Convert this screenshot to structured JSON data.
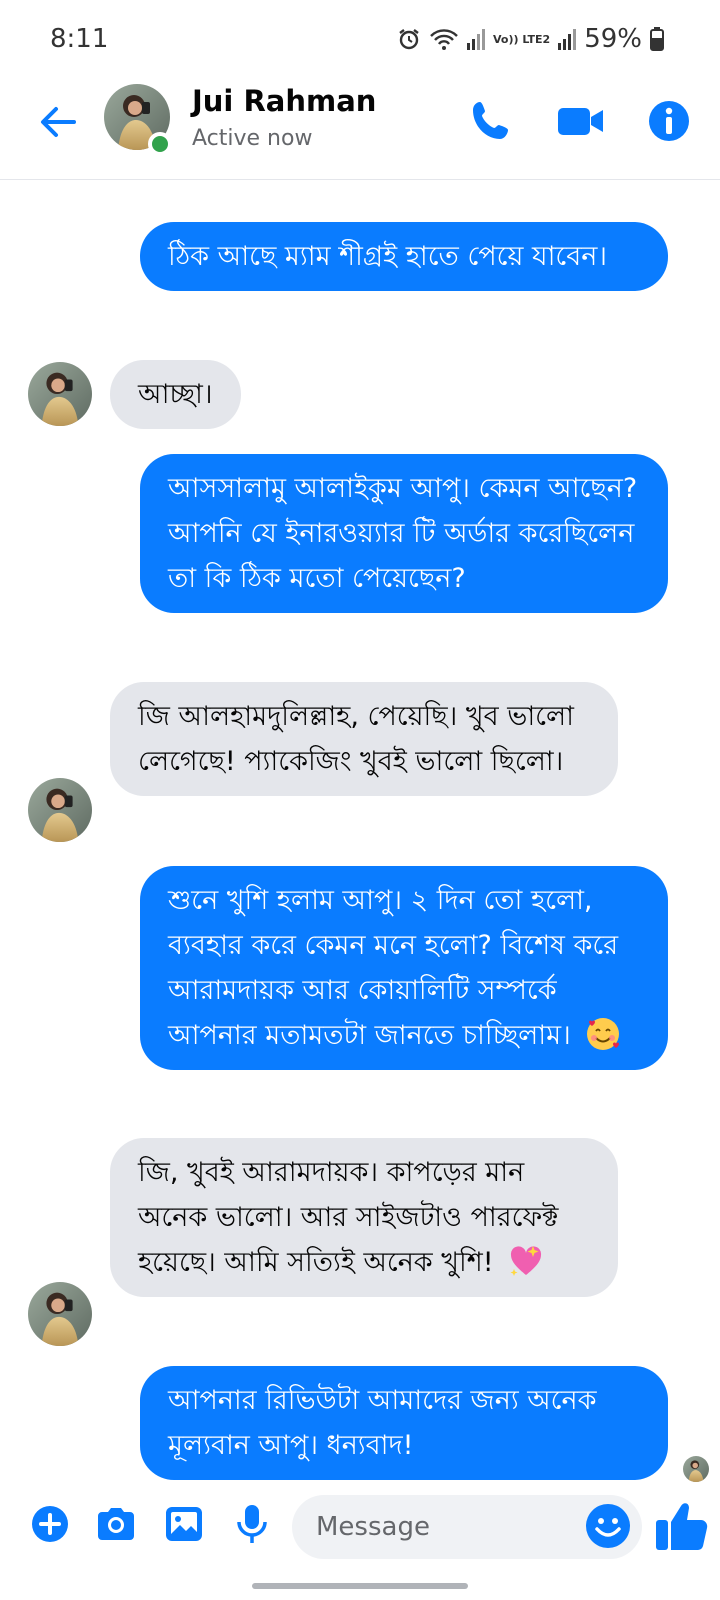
{
  "status_bar": {
    "time": "8:11",
    "network_label": "Vo)) LTE2",
    "battery": "59%"
  },
  "header": {
    "name": "Jui Rahman",
    "status": "Active now"
  },
  "messages": [
    {
      "direction": "out",
      "text": "ঠিক আছে ম্যাম শীগ্রই হাতে পেয়ে যাবেন।"
    },
    {
      "direction": "in",
      "text": "আচ্ছা।"
    },
    {
      "direction": "out",
      "text": "আসসালামু আলাইকুম আপু। কেমন আছেন? আপনি যে ইনারওয়্যার টি অর্ডার করেছিলেন তা কি ঠিক মতো পেয়েছেন?"
    },
    {
      "direction": "in",
      "text": "জি আলহামদুলিল্লাহ, পেয়েছি। খুব ভালো লেগেছে! প্যাকেজিং খুবই ভালো ছিলো।"
    },
    {
      "direction": "out",
      "text": "শুনে খুশি হলাম আপু। ২ দিন তো হলো, ব্যবহার করে কেমন মনে হলো? বিশেষ করে আরামদায়ক আর কোয়ালিটি সম্পর্কে আপনার মতামতটা জানতে চাচ্ছিলাম।",
      "emoji": "smiling-face-with-hearts"
    },
    {
      "direction": "in",
      "text": "জি, খুবই আরামদায়ক। কাপড়ের মান অনেক ভালো। আর সাইজটাও পারফেক্ট হয়েছে। আমি সত্যিই অনেক খুশি!",
      "emoji": "sparkling-heart"
    },
    {
      "direction": "out",
      "text": "আপনার রিভিউটা আমাদের জন্য অনেক মূল্যবান আপু। ধন্যবাদ!"
    }
  ],
  "composer": {
    "placeholder": "Message"
  },
  "colors": {
    "accent": "#0a7cff",
    "incoming_bubble": "#e4e6eb",
    "online": "#31a24c"
  },
  "icons": [
    "back-arrow-icon",
    "phone-icon",
    "video-camera-icon",
    "info-icon",
    "plus-icon",
    "camera-icon",
    "gallery-icon",
    "microphone-icon",
    "emoji-icon",
    "thumbs-up-icon"
  ]
}
